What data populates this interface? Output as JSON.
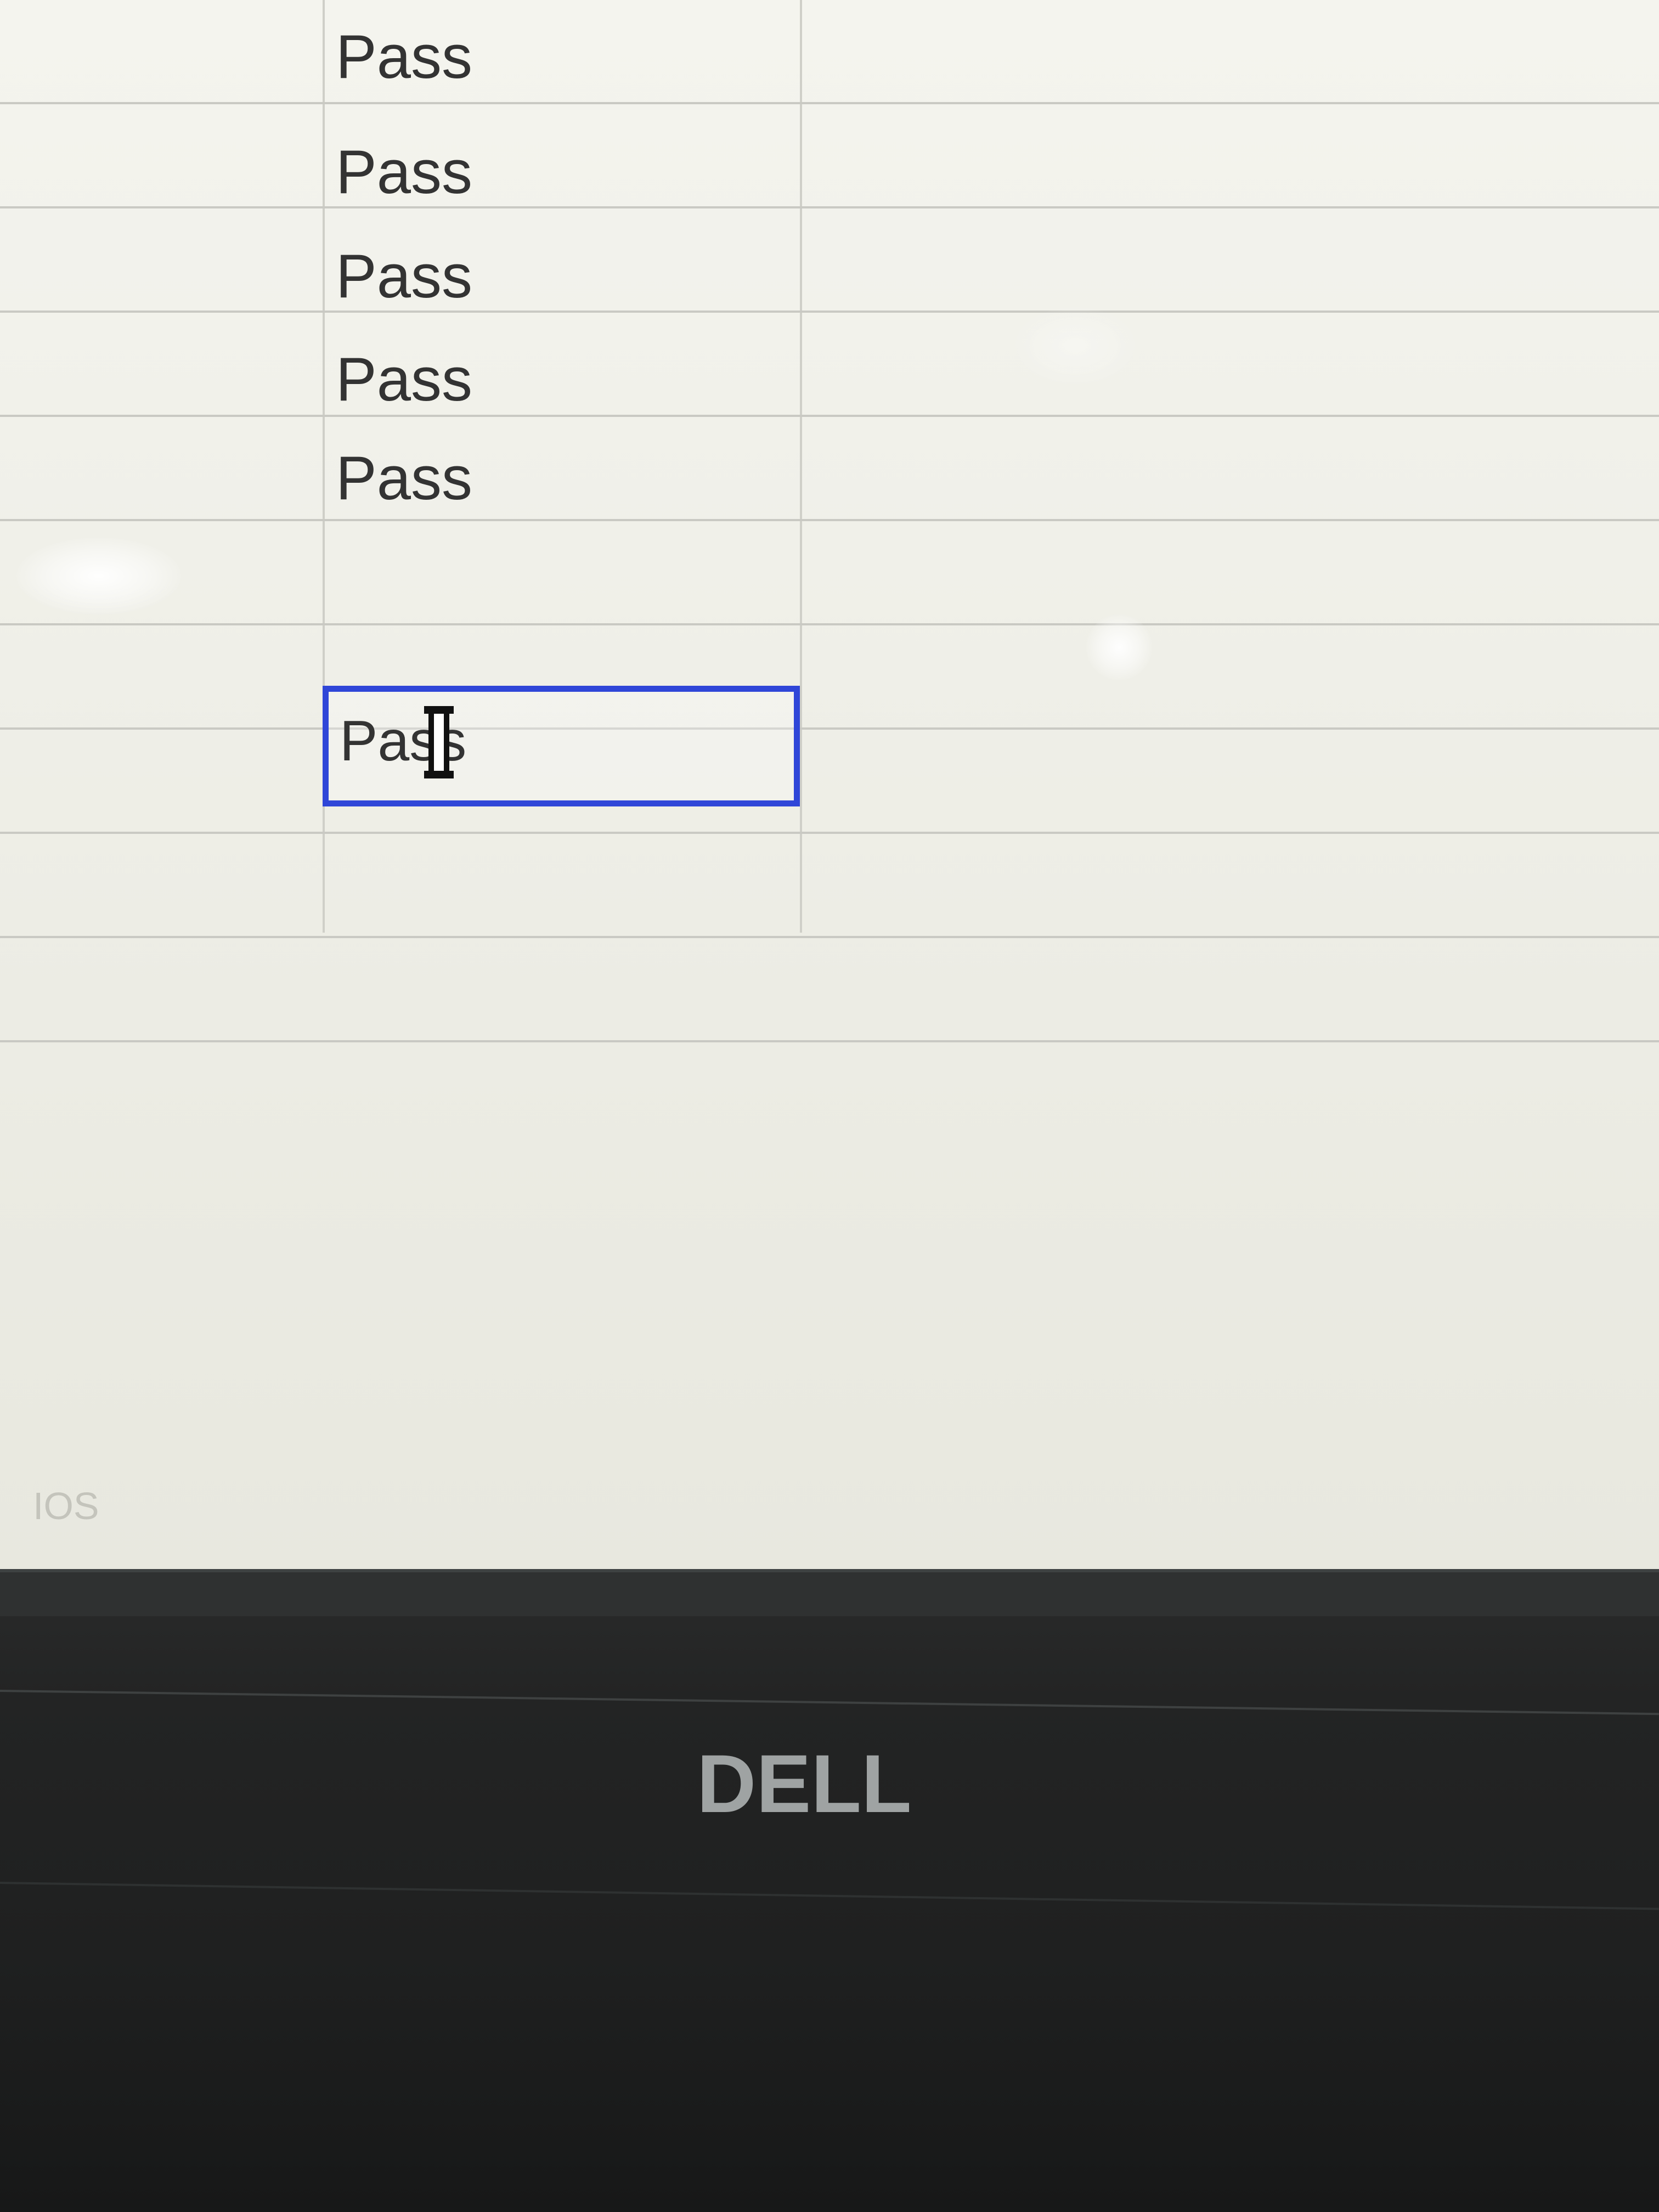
{
  "spreadsheet": {
    "rows": [
      {
        "value": "Pass"
      },
      {
        "value": "Pass"
      },
      {
        "value": "Pass"
      },
      {
        "value": "Pass"
      },
      {
        "value": "Pass"
      },
      {
        "value": ""
      },
      {
        "value": ""
      }
    ],
    "active_cell": {
      "value": "Pass"
    },
    "footer_tab": "IOS"
  },
  "monitor": {
    "brand": "DELL"
  },
  "colors": {
    "selection": "#2f46d8",
    "screen": "#f0f0e9",
    "bezel": "#222323"
  }
}
